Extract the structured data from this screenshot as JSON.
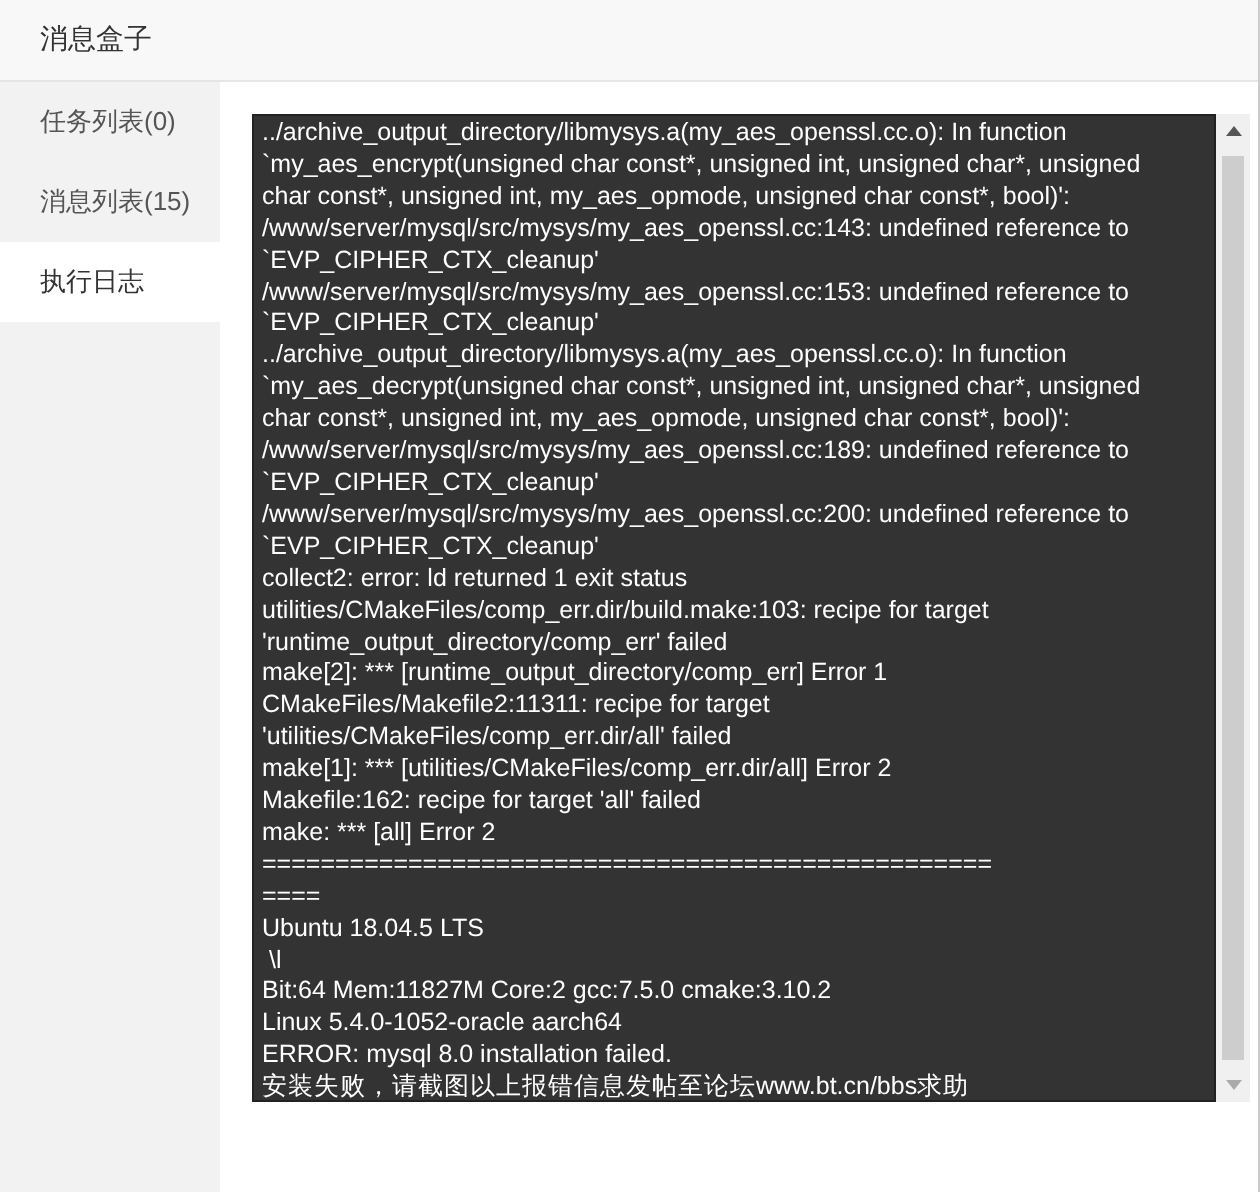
{
  "window": {
    "title": "消息盒子"
  },
  "sidebar": {
    "items": [
      {
        "label": "任务列表(0)",
        "selected": false
      },
      {
        "label": "消息列表(15)",
        "selected": false
      },
      {
        "label": "执行日志",
        "selected": true
      }
    ]
  },
  "log": {
    "lines": [
      "../archive_output_directory/libmysys.a(my_aes_openssl.cc.o): In function",
      "`my_aes_encrypt(unsigned char const*, unsigned int, unsigned char*, unsigned",
      "char const*, unsigned int, my_aes_opmode, unsigned char const*, bool)':",
      "/www/server/mysql/src/mysys/my_aes_openssl.cc:143: undefined reference to",
      "`EVP_CIPHER_CTX_cleanup'",
      "/www/server/mysql/src/mysys/my_aes_openssl.cc:153: undefined reference to",
      "`EVP_CIPHER_CTX_cleanup'",
      "../archive_output_directory/libmysys.a(my_aes_openssl.cc.o): In function",
      "`my_aes_decrypt(unsigned char const*, unsigned int, unsigned char*, unsigned",
      "char const*, unsigned int, my_aes_opmode, unsigned char const*, bool)':",
      "/www/server/mysql/src/mysys/my_aes_openssl.cc:189: undefined reference to",
      "`EVP_CIPHER_CTX_cleanup'",
      "/www/server/mysql/src/mysys/my_aes_openssl.cc:200: undefined reference to",
      "`EVP_CIPHER_CTX_cleanup'",
      "collect2: error: ld returned 1 exit status",
      "utilities/CMakeFiles/comp_err.dir/build.make:103: recipe for target",
      "'runtime_output_directory/comp_err' failed",
      "make[2]: *** [runtime_output_directory/comp_err] Error 1",
      "CMakeFiles/Makefile2:11311: recipe for target",
      "'utilities/CMakeFiles/comp_err.dir/all' failed",
      "make[1]: *** [utilities/CMakeFiles/comp_err.dir/all] Error 2",
      "Makefile:162: recipe for target 'all' failed",
      "make: *** [all] Error 2",
      "==================================================",
      "====",
      "Ubuntu 18.04.5 LTS",
      " \\l",
      "Bit:64 Mem:11827M Core:2 gcc:7.5.0 cmake:3.10.2",
      "Linux 5.4.0-1052-oracle aarch64",
      "ERROR: mysql 8.0 installation failed.",
      "安装失败，请截图以上报错信息发帖至论坛www.bt.cn/bbs求助"
    ]
  }
}
